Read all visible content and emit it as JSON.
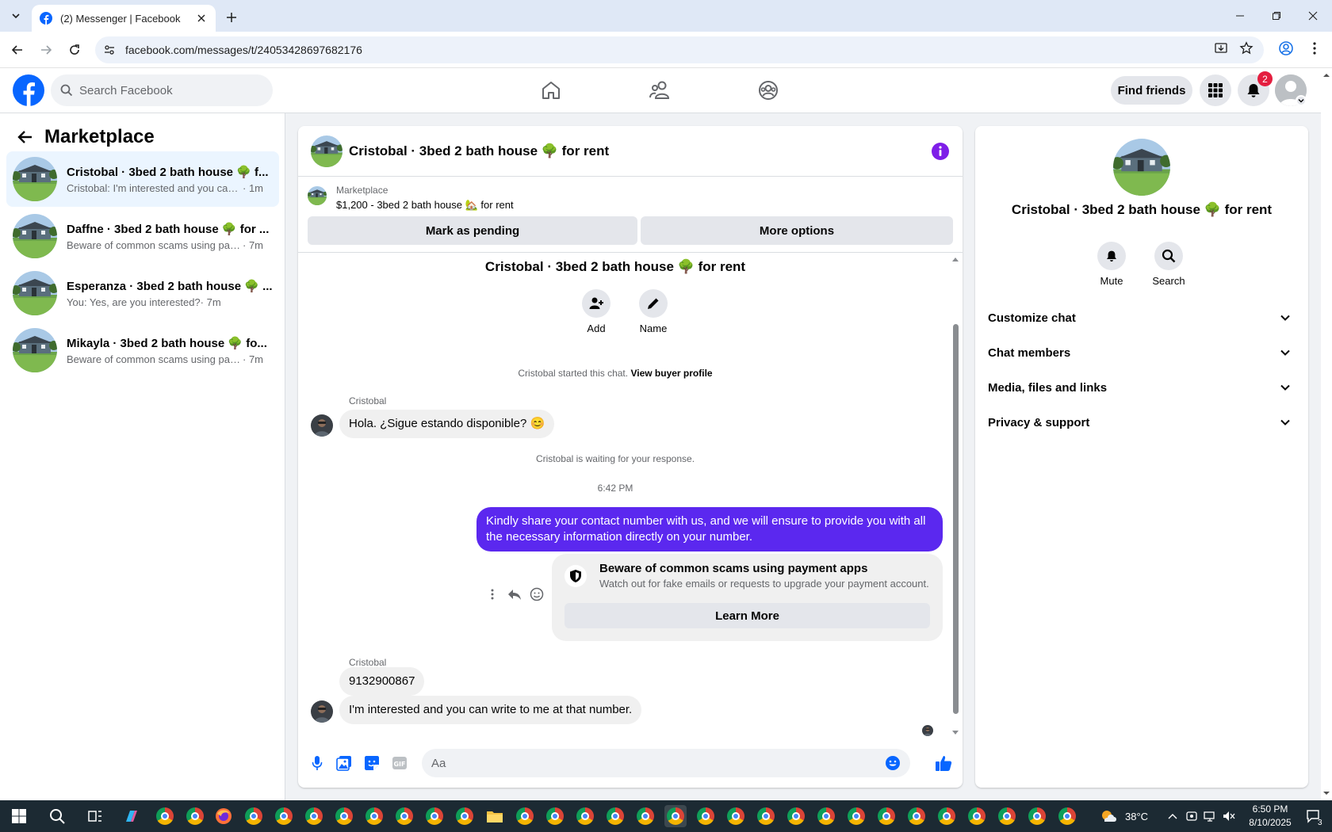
{
  "browser": {
    "tab_title": "(2) Messenger | Facebook",
    "url": "facebook.com/messages/t/24053428697682176"
  },
  "header": {
    "search_placeholder": "Search Facebook",
    "find_friends": "Find friends",
    "notification_count": "2"
  },
  "sidebar": {
    "title": "Marketplace",
    "conversations": [
      {
        "name": "Cristobal · 3bed 2 bath house 🌳 f...",
        "preview": "Cristobal: I'm interested and you can ...",
        "time": "· 1m",
        "active": true
      },
      {
        "name": "Daffne · 3bed 2 bath house 🌳 for ...",
        "preview": "Beware of common scams using pay...",
        "time": "· 7m",
        "active": false
      },
      {
        "name": "Esperanza · 3bed 2 bath house 🌳 ...",
        "preview": "You: Yes, are you interested?",
        "time": "· 7m",
        "active": false
      },
      {
        "name": "Mikayla · 3bed 2 bath house 🌳 fo...",
        "preview": "Beware of common scams using pay...",
        "time": "· 7m",
        "active": false
      }
    ]
  },
  "chat": {
    "title": "Cristobal · 3bed 2 bath house 🌳 for rent",
    "listing_label": "Marketplace",
    "listing_text": "$1,200 - 3bed 2 bath house 🏡 for rent",
    "mark_pending": "Mark as pending",
    "more_options": "More options",
    "center_title": "Cristobal · 3bed 2 bath house 🌳 for rent",
    "add_label": "Add",
    "name_label": "Name",
    "started_text": "Cristobal started this chat.",
    "view_buyer": "View buyer profile",
    "sender1": "Cristobal",
    "msg1": "Hola. ¿Sigue estando disponible? 😊",
    "waiting": "Cristobal is waiting for your response.",
    "time": "6:42 PM",
    "my_msg": "Kindly share your contact number with us, and we will ensure to provide you with all the necessary information directly on your number.",
    "scam_title": "Beware of common scams using payment apps",
    "scam_sub": "Watch out for fake emails or requests to upgrade your payment account.",
    "learn_more": "Learn More",
    "sender2": "Cristobal",
    "msg2": "9132900867",
    "msg3": "I'm interested and you can write to me at that number.",
    "composer_placeholder": "Aa"
  },
  "right_panel": {
    "name": "Cristobal · 3bed 2 bath house 🌳 for rent",
    "mute": "Mute",
    "search": "Search",
    "sections": [
      "Customize chat",
      "Chat members",
      "Media, files and links",
      "Privacy & support"
    ]
  },
  "taskbar": {
    "temperature": "38°C",
    "time": "6:50 PM",
    "date": "8/10/2025",
    "notif_count": "3"
  },
  "colors": {
    "fb_blue": "#0866ff",
    "my_bubble": "#5b28ef",
    "active_conv": "#ebf5ff",
    "badge_red": "#e41e3f"
  }
}
